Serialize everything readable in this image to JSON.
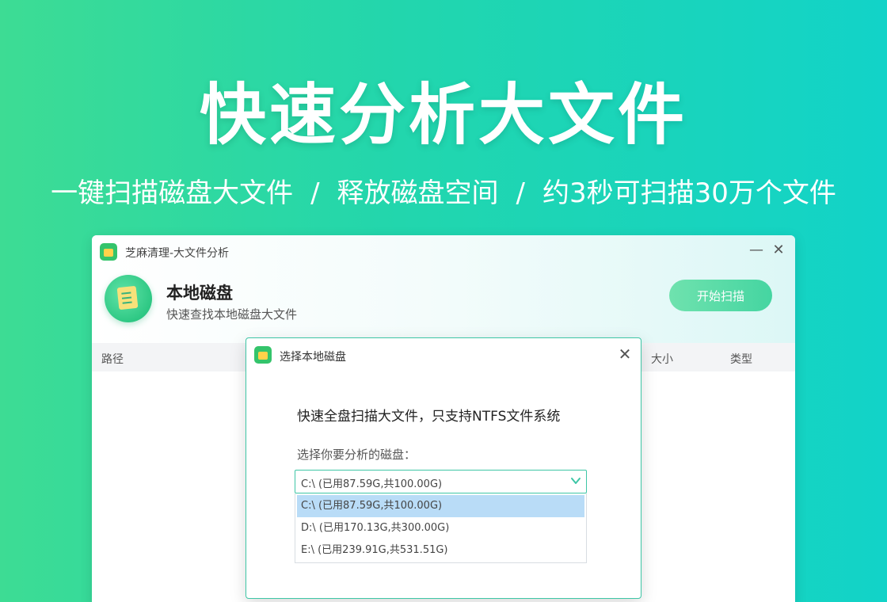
{
  "hero": {
    "title": "快速分析大文件",
    "subtitle_parts": [
      "一键扫描磁盘大文件",
      "/",
      "释放磁盘空间",
      "/",
      "约3秒可扫描30万个文件"
    ]
  },
  "window": {
    "title": "芝麻清理-大文件分析",
    "minimize": "—",
    "close": "✕",
    "header": {
      "title": "本地磁盘",
      "subtitle": "快速查找本地磁盘大文件",
      "scan_button": "开始扫描"
    },
    "table": {
      "columns": {
        "path": "路径",
        "size": "大小",
        "type": "类型"
      }
    }
  },
  "dialog": {
    "title": "选择本地磁盘",
    "close": "✕",
    "heading": "快速全盘扫描大文件，只支持NTFS文件系统",
    "label": "选择你要分析的磁盘：",
    "selected_value": "C:\\    (已用87.59G,共100.00G)",
    "options": [
      {
        "label": "C:\\    (已用87.59G,共100.00G)",
        "selected": true
      },
      {
        "label": "D:\\    (已用170.13G,共300.00G)",
        "selected": false
      },
      {
        "label": "E:\\    (已用239.91G,共531.51G)",
        "selected": false
      }
    ]
  },
  "icons": {
    "app_logo": "app-logo-icon",
    "header": "document-icon",
    "chevron": "chevron-down-icon"
  },
  "colors": {
    "accent": "#3ec6a6",
    "scan_button": "#56d9a6",
    "selected_option": "#b9dcf7",
    "background_start": "#3ddc94",
    "background_end": "#12d3c8"
  }
}
